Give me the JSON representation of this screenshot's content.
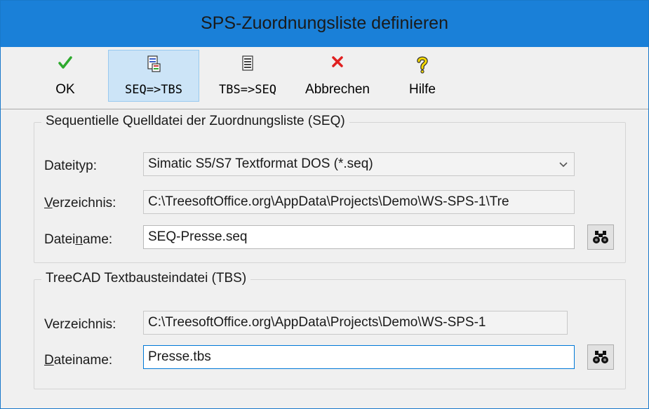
{
  "window": {
    "title": "SPS-Zuordnungsliste definieren"
  },
  "toolbar": {
    "ok": "OK",
    "seq_to_tbs": "SEQ=>TBS",
    "tbs_to_seq": "TBS=>SEQ",
    "cancel": "Abbrechen",
    "help": "Hilfe"
  },
  "seq_group": {
    "legend": "Sequentielle Quelldatei der Zuordnungsliste (SEQ)",
    "filetype_label": "Dateityp:",
    "filetype_value": "Simatic S5/S7 Textformat DOS (*.seq)",
    "directory_label_accel": "V",
    "directory_label_rest": "erzeichnis:",
    "directory_value": "C:\\TreesoftOffice.org\\AppData\\Projects\\Demo\\WS-SPS-1\\Tre",
    "filename_label_pre": "Datei",
    "filename_label_accel": "n",
    "filename_label_post": "ame:",
    "filename_value": "SEQ-Presse.seq"
  },
  "tbs_group": {
    "legend": "TreeCAD Textbausteindatei (TBS)",
    "directory_label": "Verzeichnis:",
    "directory_value": "C:\\TreesoftOffice.org\\AppData\\Projects\\Demo\\WS-SPS-1",
    "filename_label_accel": "D",
    "filename_label_rest": "ateiname:",
    "filename_value": "Presse.tbs"
  },
  "icons": {
    "ok": "checkmark-icon",
    "seq_to_tbs": "document-convert-icon",
    "tbs_to_seq": "document-list-icon",
    "cancel": "cross-icon",
    "help": "question-mark-icon",
    "browse": "binoculars-icon"
  },
  "colors": {
    "titlebar": "#1a80d8",
    "ok_check": "#2eaa2e",
    "cancel_cross": "#e02020",
    "help_yellow": "#f5d800",
    "focus_border": "#0078d7"
  }
}
